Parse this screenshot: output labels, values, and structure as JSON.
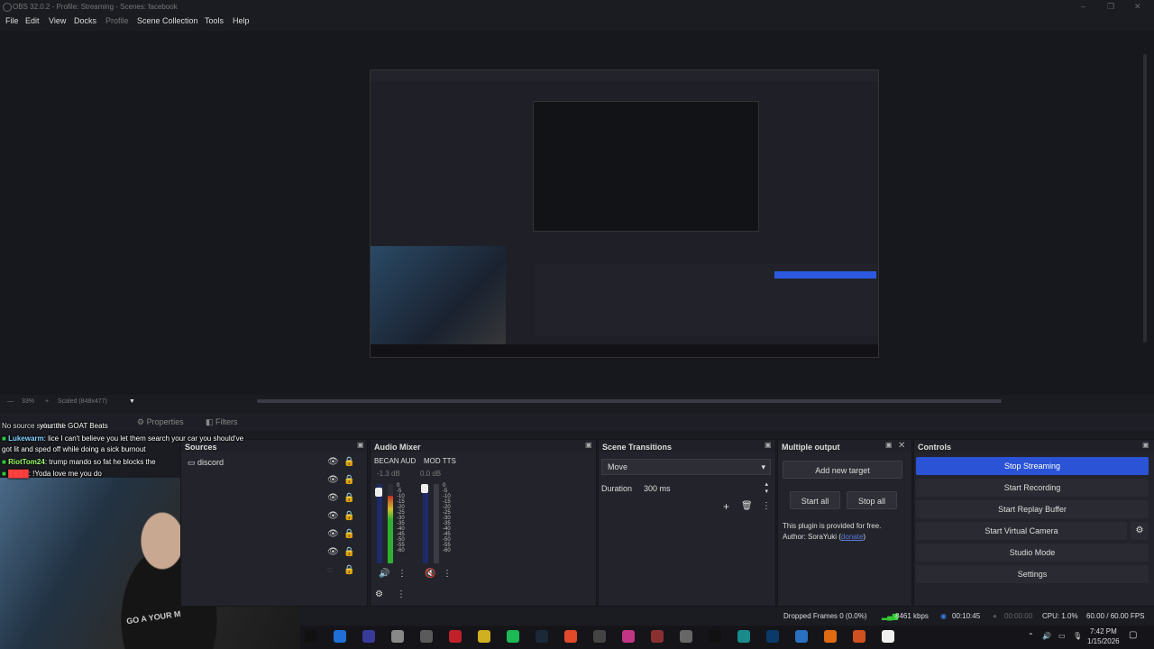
{
  "window": {
    "title": "OBS 32.0.2 - Profile: Streaming - Scenes: facebook",
    "minimize": "–",
    "maximize": "❐",
    "close": "✕"
  },
  "menu": [
    "File",
    "Edit",
    "View",
    "Docks",
    "Profile",
    "Scene Collection",
    "Tools",
    "Help"
  ],
  "preview": {
    "zoom": "33%",
    "scale": "Scaled (848x477)"
  },
  "source_bar": {
    "no_source": "No source selected",
    "properties": "Properties",
    "filters": "Filters"
  },
  "chat": [
    {
      "user": "",
      "text": "your the GOAT Beats"
    },
    {
      "user": "Lukewarm",
      "text": ": lice I can't believe you let them search your car you should've"
    },
    {
      "user": "",
      "text": "got lit and sped off while doing a sick burnout"
    },
    {
      "user": "RiotTom24",
      "text": ": trump mando so fat he blocks the"
    },
    {
      "user": "",
      "text": ": !Yoda love me you do"
    }
  ],
  "webcam": {
    "shirt": "GO A YOUR M"
  },
  "sources": {
    "title": "Sources",
    "items": [
      {
        "name": "discord"
      },
      {
        "name": ""
      },
      {
        "name": ""
      },
      {
        "name": ""
      },
      {
        "name": ""
      },
      {
        "name": ""
      },
      {
        "name": ""
      }
    ]
  },
  "mixer": {
    "title": "Audio Mixer",
    "channels": [
      {
        "name": "BECAN AUD",
        "db": "-1.3 dB",
        "level": 0.85
      },
      {
        "name": "MOD TTS",
        "db": "0.0 dB",
        "level": 0.0
      }
    ],
    "scale": [
      "0",
      "-5",
      "-10",
      "-15",
      "-20",
      "-25",
      "-30",
      "-35",
      "-40",
      "-45",
      "-50",
      "-55",
      "-60"
    ]
  },
  "transitions": {
    "title": "Scene Transitions",
    "selected": "Move",
    "duration_label": "Duration",
    "duration": "300 ms"
  },
  "multi_output": {
    "title": "Multiple output",
    "add_target": "Add new target",
    "start_all": "Start all",
    "stop_all": "Stop all",
    "note": "This plugin is provided for free.",
    "author": "Author: SoraYuki (",
    "donate": "donate",
    "author_end": ")"
  },
  "controls": {
    "title": "Controls",
    "stop_streaming": "Stop Streaming",
    "start_recording": "Start Recording",
    "start_replay": "Start Replay Buffer",
    "start_virtual_cam": "Start Virtual Camera",
    "studio_mode": "Studio Mode",
    "settings": "Settings"
  },
  "status": {
    "dropped": "Dropped Frames 0 (0.0%)",
    "bitrate": "8461 kbps",
    "stream_time": "00:10:45",
    "rec_time": "00:00:00",
    "cpu": "CPU: 1.0%",
    "fps": "60.00 / 60.00 FPS"
  },
  "taskbar": {
    "time": "7:42 PM",
    "date": "1/15/2026",
    "icons": [
      "tiktok-icon",
      "obs-icon",
      "obs-icon-2",
      "mic-icon",
      "app-icon",
      "red-icon",
      "pen-icon",
      "grammarly-icon",
      "steam-icon",
      "chrome-icon",
      "github-icon",
      "instagram-icon",
      "dl-icon",
      "app-icon-2",
      "tiktok-icon-2",
      "edge-icon",
      "photoshop-icon",
      "app-icon-3",
      "vlc-icon",
      "chrome-icon-2",
      "app-icon-4"
    ],
    "colors": [
      "#111",
      "#1f6fd6",
      "#3a3a9a",
      "#888",
      "#5a5a5a",
      "#c0202a",
      "#d0b020",
      "#1db954",
      "#1b2838",
      "#e04a2a",
      "#444",
      "#c13584",
      "#8a3030",
      "#666",
      "#111",
      "#1a8a8a",
      "#0a3a6a",
      "#2a70c0",
      "#e06a10",
      "#d05020",
      "#f0f0f0"
    ]
  }
}
